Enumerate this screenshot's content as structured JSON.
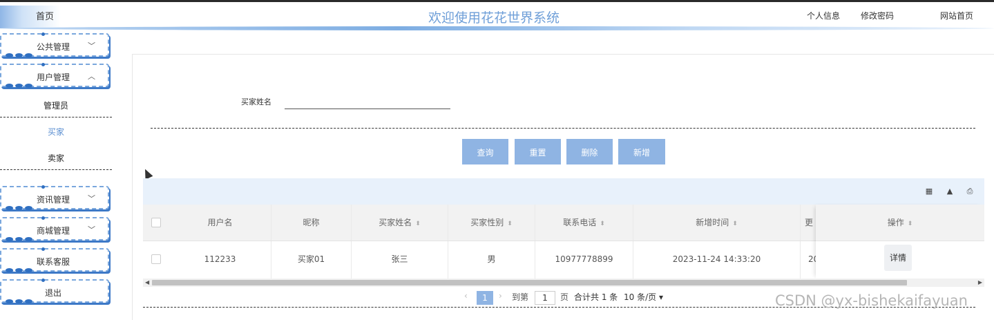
{
  "header": {
    "home_label": "首页",
    "title": "欢迎使用花花世界系统",
    "nav": [
      "个人信息",
      "修改密码",
      "网站首页"
    ]
  },
  "sidebar": {
    "menus": [
      {
        "label": "公共管理",
        "chevron": "chevron-down-icon"
      },
      {
        "label": "用户管理",
        "chevron": "chevron-up-icon"
      }
    ],
    "sub_items": [
      "管理员",
      "买家",
      "卖家"
    ],
    "active_sub": "买家",
    "menus_bottom": [
      {
        "label": "资讯管理",
        "chevron": "chevron-down-icon"
      },
      {
        "label": "商城管理",
        "chevron": "chevron-down-icon"
      },
      {
        "label": "联系客服",
        "chevron": ""
      },
      {
        "label": "退出",
        "chevron": ""
      }
    ]
  },
  "filter": {
    "label": "买家姓名",
    "value": "",
    "placeholder": ""
  },
  "actions": [
    "查询",
    "重置",
    "删除",
    "新增"
  ],
  "table": {
    "columns": [
      "用户名",
      "昵称",
      "买家姓名",
      "买家性别",
      "联系电话",
      "新增时间",
      "更",
      "操作"
    ],
    "sortable": [
      false,
      false,
      true,
      true,
      true,
      true,
      false,
      true
    ],
    "rows": [
      {
        "cells": [
          "112233",
          "买家01",
          "张三",
          "男",
          "10977778899",
          "2023-11-24 14:33:20",
          "20"
        ],
        "action": "详情"
      }
    ],
    "toolbar_icons": [
      "columns-icon",
      "export-icon",
      "print-icon"
    ]
  },
  "pagination": {
    "prev": "‹",
    "current_page": "1",
    "next": "›",
    "goto_label": "到第",
    "goto_value": "1",
    "page_unit": "页",
    "total_text": "合计共 1 条",
    "page_size": "10 条/页"
  },
  "watermark": "CSDN @yx-bishekaifayuan",
  "colors": {
    "accent": "#8fb4e3",
    "title": "#6f9fd8",
    "sidebar_shadow": "#3d79c7"
  }
}
